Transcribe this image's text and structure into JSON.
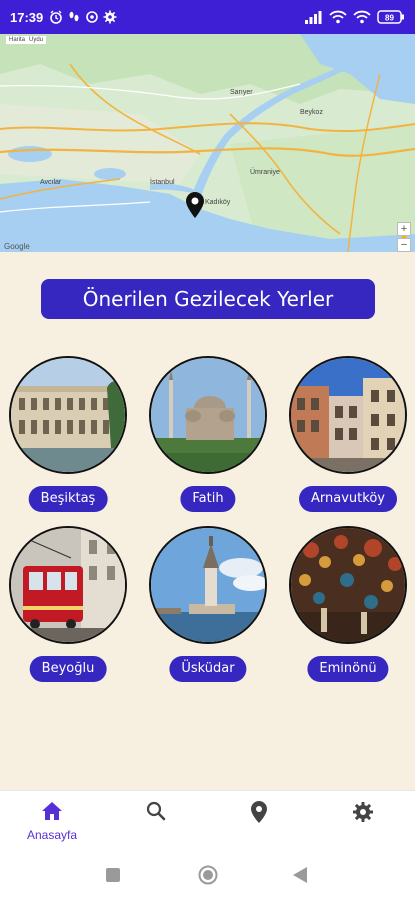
{
  "status_bar": {
    "time": "17:39",
    "battery": "89"
  },
  "map": {
    "tabs": [
      "Harita",
      "Uydu"
    ],
    "zoom_in": "+",
    "zoom_out": "−",
    "attribution": "Google",
    "city_labels": [
      "İstanbul",
      "Kadıköy",
      "Beykoz",
      "Sarıyer",
      "Ümraniye",
      "Avcılar"
    ]
  },
  "main": {
    "title": "Önerilen Gezilecek Yerler",
    "places": [
      {
        "name": "Beşiktaş"
      },
      {
        "name": "Fatih"
      },
      {
        "name": "Arnavutköy"
      },
      {
        "name": "Beyoğlu"
      },
      {
        "name": "Üsküdar"
      },
      {
        "name": "Eminönü"
      }
    ]
  },
  "bottom_nav": {
    "items": [
      {
        "label": "Anasayfa",
        "icon": "home-icon",
        "active": true
      },
      {
        "label": "",
        "icon": "search-icon",
        "active": false
      },
      {
        "label": "",
        "icon": "location-pin-icon",
        "active": false
      },
      {
        "label": "",
        "icon": "settings-icon",
        "active": false
      }
    ]
  },
  "colors": {
    "accent": "#3f1fd6",
    "button": "#3527c0",
    "background": "#f7f0e1"
  }
}
